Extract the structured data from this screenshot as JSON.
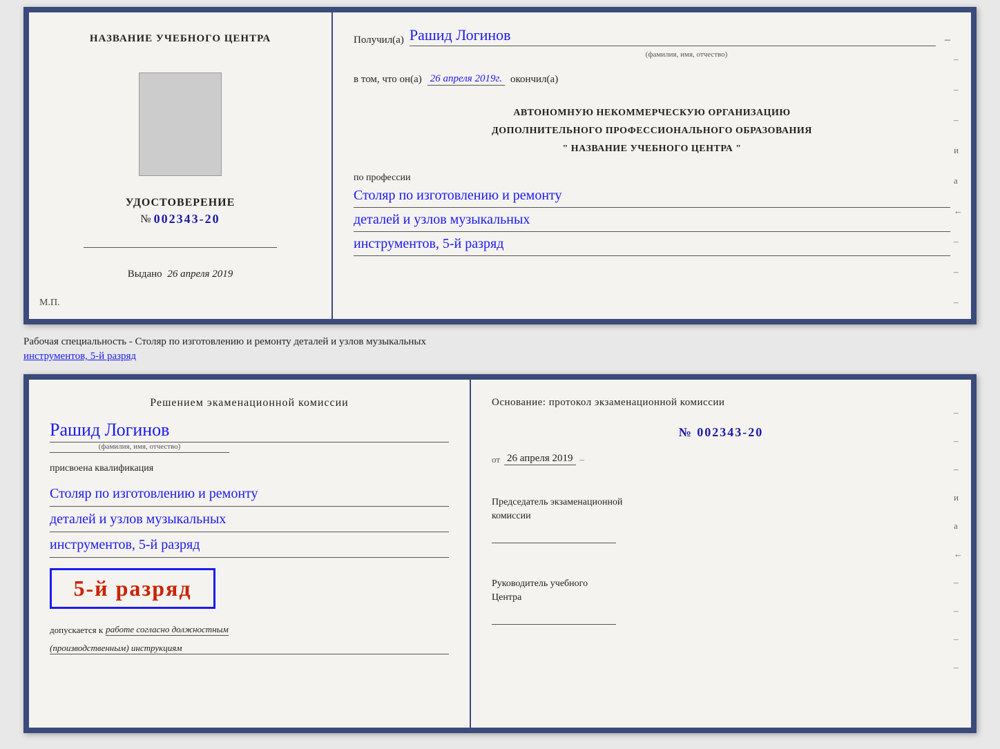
{
  "top_cert": {
    "left": {
      "title": "НАЗВАНИЕ УЧЕБНОГО ЦЕНТРА",
      "udost_label": "УДОСТОВЕРЕНИЕ",
      "udost_number_prefix": "№",
      "udost_number": "002343-20",
      "vydano_label": "Выдано",
      "vydano_date": "26 апреля 2019",
      "mp_label": "М.П."
    },
    "right": {
      "poluchil_label": "Получил(a)",
      "recipient_name": "Рашид Логинов",
      "name_sublabel": "(фамилия, имя, отчество)",
      "vtom_label": "в том, что он(а)",
      "date_value": "26 апреля 2019г.",
      "okonchil_label": "окончил(а)",
      "dash": "–",
      "main_text_line1": "АВТОНОМНУЮ НЕКОММЕРЧЕСКУЮ ОРГАНИЗАЦИЮ",
      "main_text_line2": "ДОПОЛНИТЕЛЬНОГО ПРОФЕССИОНАЛЬНОГО ОБРАЗОВАНИЯ",
      "main_text_line3": "\"   НАЗВАНИЕ УЧЕБНОГО ЦЕНТРА   \"",
      "po_professii": "по профессии",
      "profession_line1": "Столяр по изготовлению и ремонту",
      "profession_line2": "деталей и узлов музыкальных",
      "profession_line3": "инструментов, 5-й разряд"
    }
  },
  "middle_text": {
    "line1": "Рабочая специальность - Столяр по изготовлению и ремонту деталей и узлов музыкальных",
    "line2": "инструментов, 5-й разряд"
  },
  "bottom_cert": {
    "left": {
      "decision_title": "Решением экаменационной комиссии",
      "recipient_name": "Рашид Логинов",
      "name_sublabel": "(фамилия, имя, отчество)",
      "prisvoena_label": "присвоена квалификация",
      "profession_line1": "Столяр по изготовлению и ремонту",
      "profession_line2": "деталей и узлов музыкальных",
      "profession_line3": "инструментов, 5-й разряд",
      "rank_text": "5-й разряд",
      "dopuskaetsya_label": "допускается к",
      "dopuskaetsya_value": "работе согласно должностным",
      "dopuskaetsya_value2": "(производственным) инструкциям"
    },
    "right": {
      "osnov_label": "Основание: протокол экзаменационной комиссии",
      "protocol_number": "№  002343-20",
      "ot_label": "от",
      "ot_date": "26 апреля 2019",
      "predsedatel_label": "Председатель экзаменационной",
      "predsedatel_label2": "комиссии",
      "rukovoditel_label": "Руководитель учебного",
      "rukovoditel_label2": "Центра"
    },
    "right_chars": [
      "–",
      "–",
      "–",
      "и",
      "а",
      "←",
      "–",
      "–",
      "–",
      "–"
    ]
  }
}
